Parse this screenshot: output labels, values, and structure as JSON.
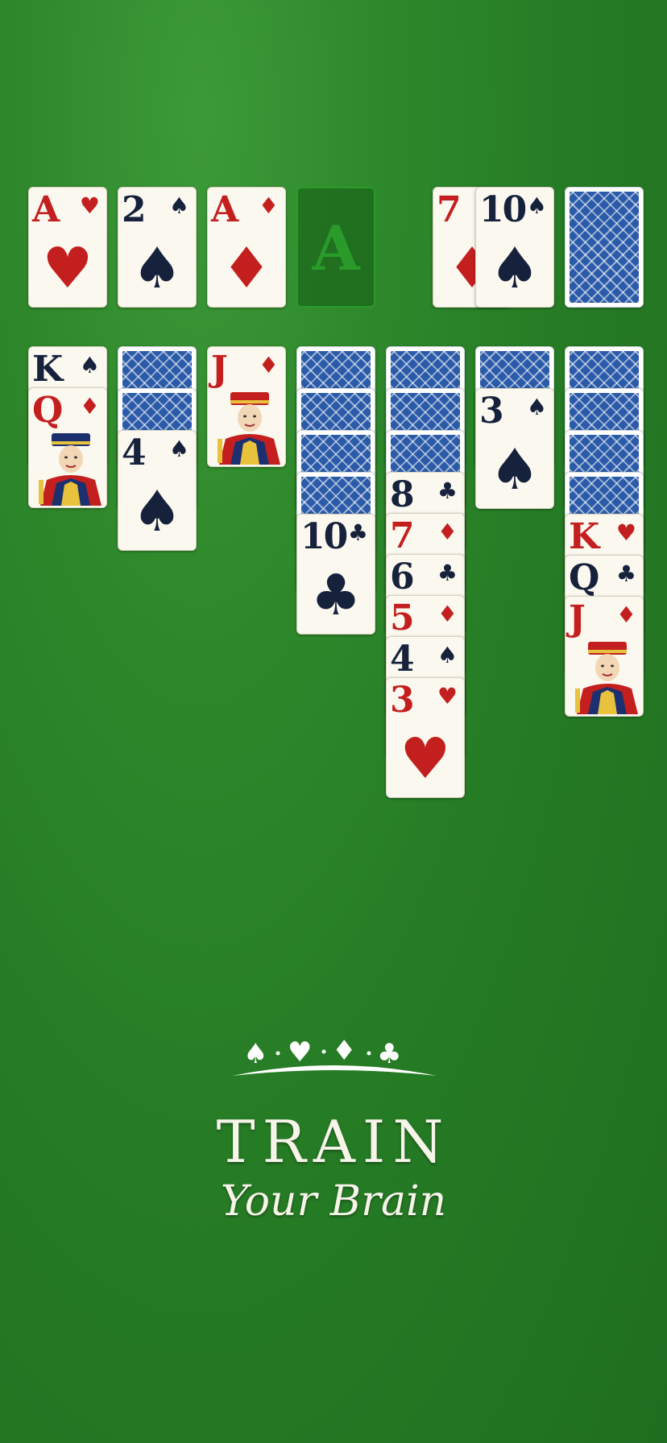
{
  "foundations": [
    {
      "rank": "A",
      "suit": "♥",
      "color": "red"
    },
    {
      "rank": "2",
      "suit": "♠",
      "color": "black"
    },
    {
      "rank": "A",
      "suit": "♦",
      "color": "red"
    },
    {
      "placeholder": "A"
    }
  ],
  "waste": [
    {
      "rank": "7",
      "suit": "♦",
      "color": "red"
    },
    {
      "rank": "10",
      "suit": "♠",
      "color": "black"
    }
  ],
  "stock": {
    "face_down": true
  },
  "tableau": [
    {
      "face_down": 0,
      "cards": [
        {
          "rank": "K",
          "suit": "♠",
          "color": "black"
        },
        {
          "rank": "Q",
          "suit": "♦",
          "color": "red",
          "face": "queen"
        }
      ]
    },
    {
      "face_down": 2,
      "cards": [
        {
          "rank": "4",
          "suit": "♠",
          "color": "black"
        }
      ]
    },
    {
      "face_down": 0,
      "cards": [
        {
          "rank": "J",
          "suit": "♦",
          "color": "red",
          "face": "jack"
        }
      ]
    },
    {
      "face_down": 4,
      "cards": [
        {
          "rank": "10",
          "suit": "♣",
          "color": "black"
        }
      ]
    },
    {
      "face_down": 3,
      "cards": [
        {
          "rank": "8",
          "suit": "♣",
          "color": "black"
        },
        {
          "rank": "7",
          "suit": "♦",
          "color": "red"
        },
        {
          "rank": "6",
          "suit": "♣",
          "color": "black"
        },
        {
          "rank": "5",
          "suit": "♦",
          "color": "red"
        },
        {
          "rank": "4",
          "suit": "♠",
          "color": "black"
        },
        {
          "rank": "3",
          "suit": "♥",
          "color": "red"
        }
      ]
    },
    {
      "face_down": 1,
      "cards": [
        {
          "rank": "3",
          "suit": "♠",
          "color": "black"
        }
      ]
    },
    {
      "face_down": 4,
      "cards": [
        {
          "rank": "K",
          "suit": "♥",
          "color": "red"
        },
        {
          "rank": "Q",
          "suit": "♣",
          "color": "black"
        },
        {
          "rank": "J",
          "suit": "♦",
          "color": "red",
          "face": "jack"
        }
      ]
    }
  ],
  "brand": {
    "suits": [
      "♠",
      "♥",
      "♦",
      "♣"
    ],
    "title": "TRAIN",
    "subtitle": "Your Brain"
  },
  "colors": {
    "felt": "#267c25",
    "red": "#c41f1f",
    "black": "#16213c",
    "card_back": "#2a5aa8"
  }
}
